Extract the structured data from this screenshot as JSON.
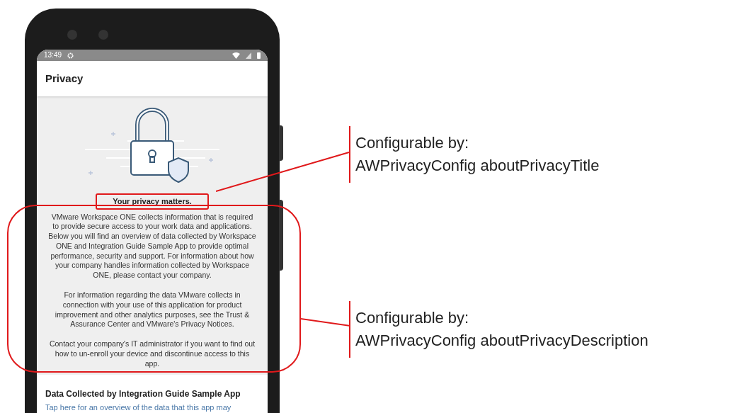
{
  "status_bar": {
    "time": "13:49"
  },
  "app_bar": {
    "title": "Privacy"
  },
  "privacy": {
    "title": "Your privacy matters.",
    "paragraphs": [
      "VMware Workspace ONE collects information that is required to provide secure access to your work data and applications. Below you will find an overview of data collected by Workspace ONE and Integration Guide Sample App to provide optimal performance, security and support. For information about how your company handles information collected by Workspace ONE, please contact your company.",
      "For information regarding the data VMware collects in connection with your use of this application for product improvement and other analytics purposes, see the Trust & Assurance Center and VMware's Privacy Notices.",
      "Contact your company's IT administrator if you want to find out how to un-enroll your device and discontinue access to this app."
    ]
  },
  "section": {
    "heading": "Data Collected by Integration Guide Sample App",
    "description": "Tap here for an overview of the data that this app may"
  },
  "callouts": [
    {
      "label": "Configurable by:",
      "key": "AWPrivacyConfig aboutPrivacyTitle"
    },
    {
      "label": "Configurable by:",
      "key": "AWPrivacyConfig aboutPrivacyDescription"
    }
  ]
}
